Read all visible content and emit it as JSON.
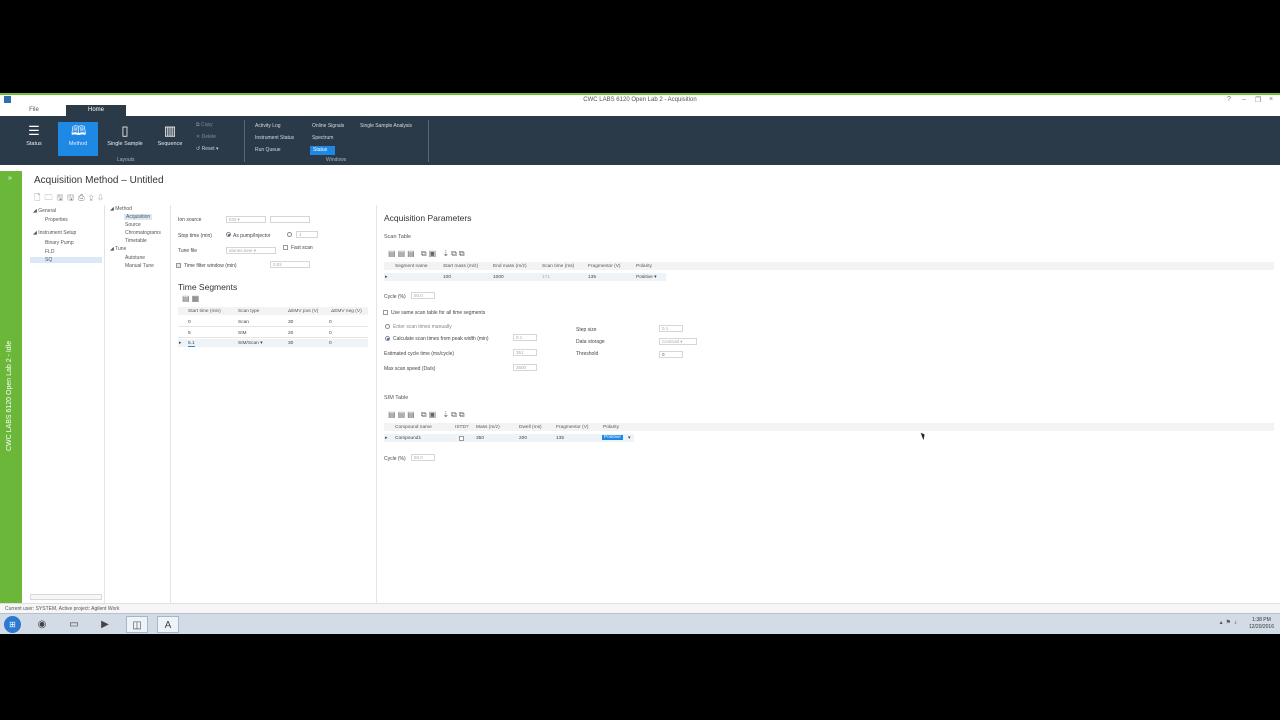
{
  "window": {
    "title": "CWC LABS 6120 Open Lab 2 - Acquisition",
    "controls": [
      "?",
      "–",
      "❐",
      "×"
    ]
  },
  "tabs": {
    "file": "File",
    "home": "Home"
  },
  "ribbon": {
    "status": "Status",
    "method": "Method",
    "single_sample": "Single Sample",
    "sequence": "Sequence",
    "copy": "Copy",
    "delete": "Delete",
    "reset": "Reset",
    "layouts_label": "Layouts",
    "windows_label": "Windows",
    "activity_log": "Activity Log",
    "instrument_status": "Instrument Status",
    "run_queue": "Run Queue",
    "online_signals": "Online Signals",
    "spectrum": "Spectrum",
    "status_win": "Status",
    "single_sample_analysis": "Single Sample Analysis"
  },
  "left_strip": {
    "vertical_text": "CWC LABS 6120 Open Lab 2 - Idle"
  },
  "page_title": "Acquisition Method – Untitled",
  "tree_left": {
    "general": "General",
    "properties": "Properties",
    "instrument_setup": "Instrument Setup",
    "binary_pump": "Binary Pump",
    "fld": "FLD",
    "sq": "SQ"
  },
  "tree_mid": {
    "method": "Method",
    "acquisition": "Acquisition",
    "source": "Source",
    "chromatograms": "Chromatograms",
    "timetable": "Timetable",
    "tune": "Tune",
    "autotune": "Autotune",
    "manual_tune": "Manual Tune"
  },
  "form": {
    "ion_source": "Ion source",
    "ion_source_value": "ESI",
    "stop_time": "Stop time (min)",
    "as_pump": "As pump/Injector",
    "stop_time_value": "1",
    "tune_file": "Tune file",
    "tune_file_value": "atunes.tune",
    "fast_scan": "Fast scan",
    "peak_filter": "Time filter window (min)",
    "peak_filter_value": "0.02"
  },
  "time_segments": {
    "title": "Time Segments",
    "headers": [
      "Start time (min)",
      "Scan type",
      "ΔEMV pos (V)",
      "ΔEMV neg (V)"
    ],
    "rows": [
      [
        "0",
        "Scan",
        "30",
        "0"
      ],
      [
        "5",
        "SIM",
        "20",
        "0"
      ],
      [
        "5.1",
        "SIM/Scan",
        "30",
        "0"
      ]
    ]
  },
  "acq": {
    "title": "Acquisition Parameters",
    "scan_table": "Scan Table",
    "scan_headers": [
      "Segment name",
      "Start mass (m/z)",
      "End mass (m/z)",
      "Scan time (ms)",
      "Fragmentor (V)",
      "Polarity"
    ],
    "scan_row": [
      "",
      "100",
      "1000",
      "171",
      "135",
      "Positive"
    ],
    "cycle_label": "Cycle (%)",
    "cycle_value": "50.0",
    "same_scan": "Use same scan table for all time segments",
    "enter_manually": "Enter scan times manually",
    "calc_peak": "Calculate scan times from peak width (min)",
    "calc_peak_value": "0.1",
    "est_cycle": "Estimated cycle time (ms/cycle)",
    "est_cycle_value": "351",
    "max_scan": "Max scan speed (Da/s)",
    "max_scan_value": "2600",
    "step_size": "Step size",
    "step_size_value": "0.1",
    "data_storage": "Data storage",
    "data_storage_value": "Centroid",
    "threshold": "Threshold",
    "threshold_value": "0"
  },
  "sim": {
    "title": "SIM Table",
    "headers": [
      "Compound name",
      "ISTD?",
      "Mass (m/z)",
      "Dwell (ms)",
      "Fragmentor (V)",
      "Polarity"
    ],
    "row": [
      "Compound1",
      "",
      "350",
      "200",
      "135",
      "Positive"
    ],
    "cycle_label": "Cycle (%)",
    "cycle_value": "50.0"
  },
  "statusbar": {
    "text": "Current user: SYSTEM, Active project: Agilent Work"
  },
  "taskbar": {
    "time": "1:38 PM",
    "date": "12/20/2016"
  }
}
